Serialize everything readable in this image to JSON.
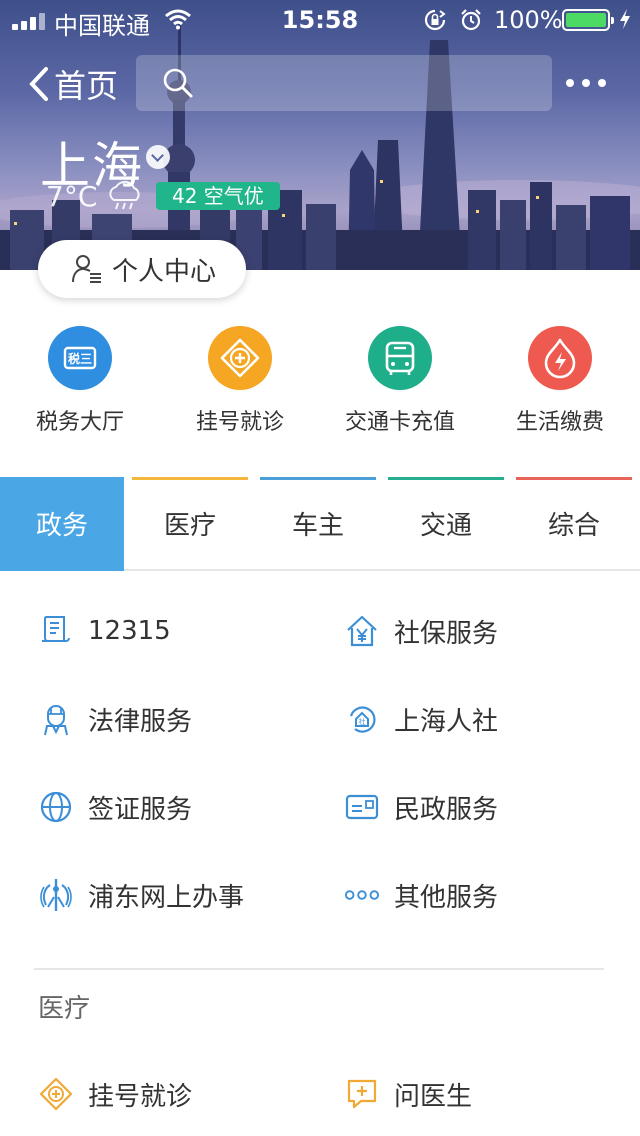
{
  "status_bar": {
    "carrier": "中国联通",
    "time": "15:58",
    "battery_pct": "100%",
    "battery_level": 1.0,
    "icons": [
      "signal-icon",
      "wifi-icon",
      "rotation-lock-icon",
      "alarm-icon",
      "battery-icon",
      "charging-icon"
    ]
  },
  "nav": {
    "back_label": "首页",
    "search_placeholder": "",
    "more_icon": "more-dots-icon"
  },
  "location": {
    "city": "上海",
    "temperature": "7°C",
    "weather_icon": "cloudy-rain-icon",
    "aqi_badge": "42 空气优"
  },
  "personal_center": {
    "label": "个人中心",
    "icon": "user-list-icon"
  },
  "quick_services": [
    {
      "label": "税务大厅",
      "icon": "tax-icon",
      "color": "#2f8ee0"
    },
    {
      "label": "挂号就诊",
      "icon": "medical-cross-icon",
      "color": "#f5a623"
    },
    {
      "label": "交通卡充值",
      "icon": "bus-icon",
      "color": "#1fae8a"
    },
    {
      "label": "生活缴费",
      "icon": "utility-bolt-icon",
      "color": "#ee5a4f"
    }
  ],
  "tabs": [
    {
      "label": "政务",
      "active": true,
      "color": "#4ba6e6"
    },
    {
      "label": "医疗",
      "active": false,
      "color": "#f5b63e"
    },
    {
      "label": "车主",
      "active": false,
      "color": "#4a9fd8"
    },
    {
      "label": "交通",
      "active": false,
      "color": "#27ae8f"
    },
    {
      "label": "综合",
      "active": false,
      "color": "#e8635a"
    }
  ],
  "gov_services": [
    {
      "label": "12315",
      "icon": "document-scroll-icon"
    },
    {
      "label": "社保服务",
      "icon": "social-security-house-icon"
    },
    {
      "label": "法律服务",
      "icon": "judge-icon"
    },
    {
      "label": "上海人社",
      "icon": "shanghai-hrss-icon"
    },
    {
      "label": "签证服务",
      "icon": "globe-icon"
    },
    {
      "label": "民政服务",
      "icon": "id-card-icon"
    },
    {
      "label": "浦东网上办事",
      "icon": "pudong-emblem-icon"
    },
    {
      "label": "其他服务",
      "icon": "more-circles-icon"
    }
  ],
  "medical_section": {
    "title": "医疗",
    "items": [
      {
        "label": "挂号就诊",
        "icon": "medical-cross-icon"
      },
      {
        "label": "问医生",
        "icon": "chat-plus-icon"
      }
    ]
  }
}
